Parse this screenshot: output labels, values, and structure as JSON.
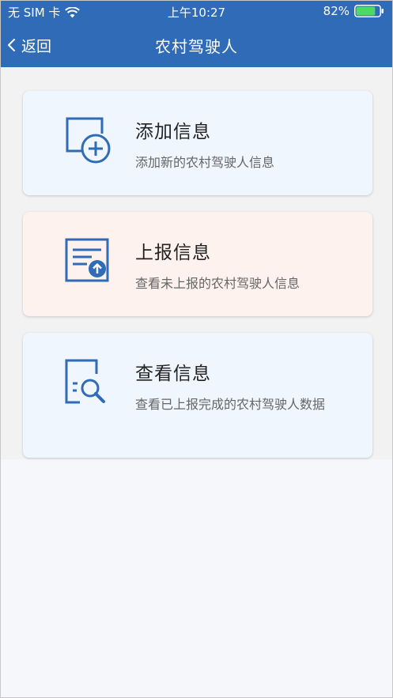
{
  "status_bar": {
    "carrier": "无 SIM 卡",
    "time": "上午10:27",
    "battery_percent": "82%",
    "battery_level": 0.82,
    "battery_color": "#4cd964"
  },
  "nav": {
    "back_label": "返回",
    "title": "农村驾驶人"
  },
  "colors": {
    "header": "#2f6bb6",
    "icon": "#2f6bb6",
    "card_blue": "#eff6fd",
    "card_peach": "#fdf2ee"
  },
  "cards": [
    {
      "title": "添加信息",
      "description": "添加新的农村驾驶人信息",
      "icon": "document-add-icon"
    },
    {
      "title": "上报信息",
      "description": "查看未上报的农村驾驶人信息",
      "icon": "document-upload-icon"
    },
    {
      "title": "查看信息",
      "description": "查看已上报完成的农村驾驶人数据",
      "icon": "document-search-icon"
    }
  ]
}
